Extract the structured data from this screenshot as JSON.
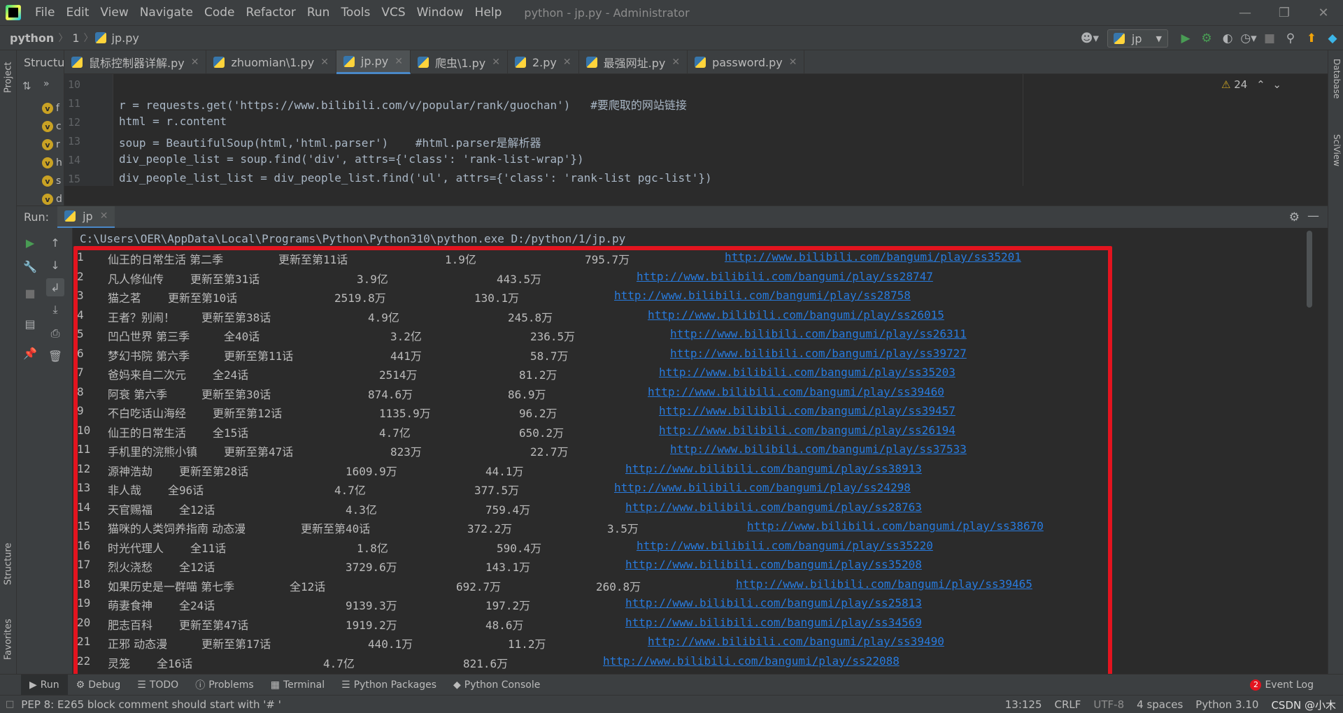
{
  "window": {
    "title": "python - jp.py - Administrator",
    "menu": [
      "File",
      "Edit",
      "View",
      "Navigate",
      "Code",
      "Refactor",
      "Run",
      "Tools",
      "VCS",
      "Window",
      "Help"
    ]
  },
  "breadcrumb": {
    "project": "python",
    "folder": "1",
    "file": "jp.py"
  },
  "run_config": {
    "name": "jp"
  },
  "structure": {
    "title": "Structure",
    "items": [
      "f",
      "c",
      "r",
      "h",
      "s",
      "d"
    ]
  },
  "tabs": [
    {
      "label": "鼠标控制器详解.py",
      "active": false
    },
    {
      "label": "zhuomian\\1.py",
      "active": false
    },
    {
      "label": "jp.py",
      "active": true
    },
    {
      "label": "爬虫\\1.py",
      "active": false
    },
    {
      "label": "2.py",
      "active": false
    },
    {
      "label": "最强网址.py",
      "active": false
    },
    {
      "label": "password.py",
      "active": false
    }
  ],
  "editor": {
    "warnings": "24",
    "lines": [
      {
        "n": "10",
        "code": ""
      },
      {
        "n": "11",
        "code": "r = requests.get('https://www.bilibili.com/v/popular/rank/guochan')   #要爬取的网站链接"
      },
      {
        "n": "12",
        "code": "html = r.content"
      },
      {
        "n": "13",
        "code": "soup = BeautifulSoup(html,'html.parser')    #html.parser是解析器"
      },
      {
        "n": "14",
        "code": "div_people_list = soup.find('div', attrs={'class': 'rank-list-wrap'})"
      },
      {
        "n": "15",
        "code": "div_people_list_list = div_people_list.find('ul', attrs={'class': 'rank-list pgc-list'})"
      }
    ]
  },
  "run": {
    "label": "Run:",
    "tab": "jp",
    "command": "C:\\Users\\OER\\AppData\\Local\\Programs\\Python\\Python310\\python.exe D:/python/1/jp.py",
    "rows": [
      [
        "1",
        "仙王的日常生活 第二季",
        "更新至第11话",
        "1.9亿",
        "795.7万",
        "http://www.bilibili.com/bangumi/play/ss35201"
      ],
      [
        "2",
        "凡人修仙传",
        "更新至第31话",
        "3.9亿",
        "443.5万",
        "http://www.bilibili.com/bangumi/play/ss28747"
      ],
      [
        "3",
        "猫之茗",
        "更新至第10话",
        "2519.8万",
        "130.1万",
        "http://www.bilibili.com/bangumi/play/ss28758"
      ],
      [
        "4",
        "王者？别闹！",
        "更新至第38话",
        "4.9亿",
        "245.8万",
        "http://www.bilibili.com/bangumi/play/ss26015"
      ],
      [
        "5",
        "凹凸世界 第三季",
        "全40话",
        "3.2亿",
        "236.5万",
        "http://www.bilibili.com/bangumi/play/ss26311"
      ],
      [
        "6",
        "梦幻书院 第六季",
        "更新至第11话",
        "441万",
        "58.7万",
        "http://www.bilibili.com/bangumi/play/ss39727"
      ],
      [
        "7",
        "爸妈来自二次元",
        "全24话",
        "2514万",
        "81.2万",
        "http://www.bilibili.com/bangumi/play/ss35203"
      ],
      [
        "8",
        "阿衰 第六季",
        "更新至第30话",
        "874.6万",
        "86.9万",
        "http://www.bilibili.com/bangumi/play/ss39460"
      ],
      [
        "9",
        "不白吃话山海经",
        "更新至第12话",
        "1135.9万",
        "96.2万",
        "http://www.bilibili.com/bangumi/play/ss39457"
      ],
      [
        "10",
        "仙王的日常生活",
        "全15话",
        "4.7亿",
        "650.2万",
        "http://www.bilibili.com/bangumi/play/ss26194"
      ],
      [
        "11",
        "手机里的浣熊小镇",
        "更新至第47话",
        "823万",
        "22.7万",
        "http://www.bilibili.com/bangumi/play/ss37533"
      ],
      [
        "12",
        "源神浩劫",
        "更新至第28话",
        "1609.9万",
        "44.1万",
        "http://www.bilibili.com/bangumi/play/ss38913"
      ],
      [
        "13",
        "非人哉",
        "全96话",
        "4.7亿",
        "377.5万",
        "http://www.bilibili.com/bangumi/play/ss24298"
      ],
      [
        "14",
        "天官赐福",
        "全12话",
        "4.3亿",
        "759.4万",
        "http://www.bilibili.com/bangumi/play/ss28763"
      ],
      [
        "15",
        "猫咪的人类饲养指南 动态漫",
        "更新至第40话",
        "372.2万",
        "3.5万",
        "http://www.bilibili.com/bangumi/play/ss38670"
      ],
      [
        "16",
        "时光代理人",
        "全11话",
        "1.8亿",
        "590.4万",
        "http://www.bilibili.com/bangumi/play/ss35220"
      ],
      [
        "17",
        "烈火浇愁",
        "全12话",
        "3729.6万",
        "143.1万",
        "http://www.bilibili.com/bangumi/play/ss35208"
      ],
      [
        "18",
        "如果历史是一群喵 第七季",
        "全12话",
        "692.7万",
        "260.8万",
        "http://www.bilibili.com/bangumi/play/ss39465"
      ],
      [
        "19",
        "萌妻食神",
        "全24话",
        "9139.3万",
        "197.2万",
        "http://www.bilibili.com/bangumi/play/ss25813"
      ],
      [
        "20",
        "肥志百科",
        "更新至第47话",
        "1919.2万",
        "48.6万",
        "http://www.bilibili.com/bangumi/play/ss34569"
      ],
      [
        "21",
        "正邪 动态漫",
        "更新至第17话",
        "440.1万",
        "11.2万",
        "http://www.bilibili.com/bangumi/play/ss39490"
      ],
      [
        "22",
        "灵笼",
        "全16话",
        "4.7亿",
        "821.6万",
        "http://www.bilibili.com/bangumi/play/ss22088"
      ]
    ]
  },
  "left_strip": {
    "project": "Project",
    "structure": "Structure",
    "favorites": "Favorites"
  },
  "right_strip": {
    "database": "Database",
    "sciview": "SciView"
  },
  "bottom_tabs": [
    "Run",
    "Debug",
    "TODO",
    "Problems",
    "Terminal",
    "Python Packages",
    "Python Console"
  ],
  "event_log": {
    "badge": "2",
    "label": "Event Log"
  },
  "status": {
    "message": "PEP 8: E265 block comment should start with '# '",
    "position": "13:125",
    "line_sep": "CRLF",
    "encoding": "UTF-8",
    "indent": "4 spaces",
    "interpreter": "Python 3.10",
    "watermark": "CSDN @小木"
  },
  "colors": {
    "highlight": "#e3141f",
    "link": "#287bde",
    "accent": "#4a88c7"
  }
}
